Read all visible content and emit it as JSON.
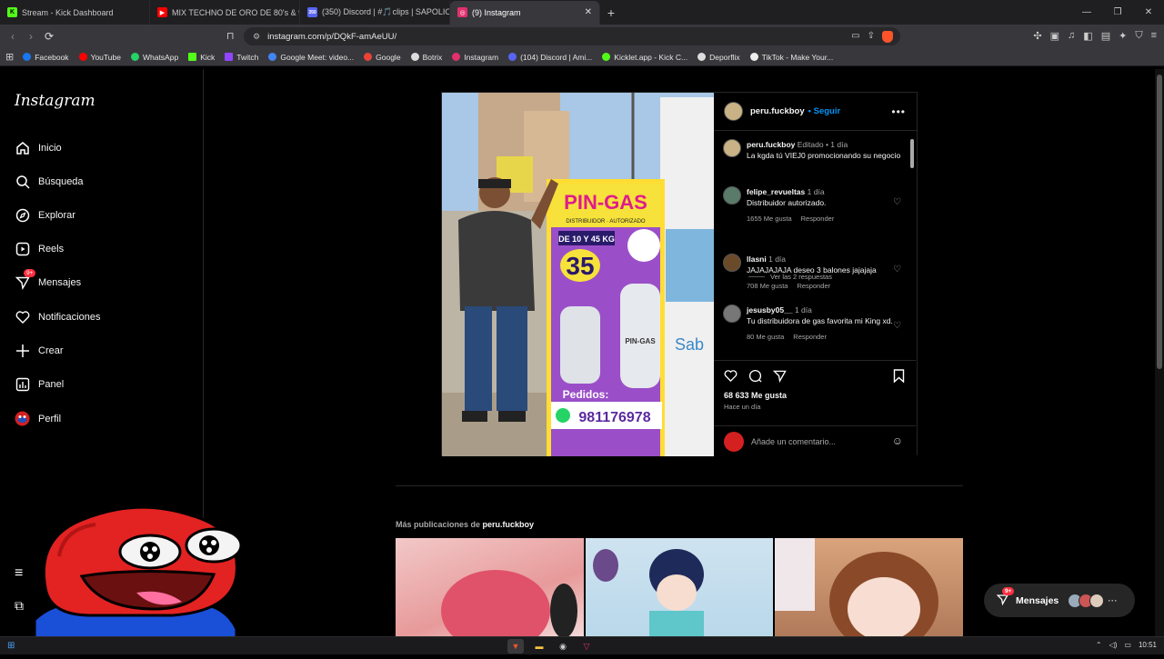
{
  "browser": {
    "tabs": [
      {
        "title": "Stream - Kick Dashboard",
        "color": "#53fc18",
        "glyph": "K"
      },
      {
        "title": "MIX TECHNO DE ORO DE 80's & 90's",
        "color": "#ff0000",
        "glyph": "▶"
      },
      {
        "title": "(350) Discord | #🎵clips | SAPOLIO",
        "color": "#5865f2",
        "glyph": "350"
      },
      {
        "title": "(9) Instagram",
        "color": "#e1306c",
        "glyph": "◎",
        "active": true
      }
    ],
    "new_tab": "+",
    "window_controls": [
      "—",
      "❐",
      "✕"
    ],
    "url": "instagram.com/p/DQkF-amAeUU/",
    "bookmarks": [
      {
        "label": "Facebook",
        "color": "#1877f2"
      },
      {
        "label": "YouTube",
        "color": "#ff0000"
      },
      {
        "label": "WhatsApp",
        "color": "#25d366"
      },
      {
        "label": "Kick",
        "color": "#53fc18"
      },
      {
        "label": "Twitch",
        "color": "#9146ff"
      },
      {
        "label": "Google Meet: video...",
        "color": "#4285f4"
      },
      {
        "label": "Google",
        "color": "#ea4335"
      },
      {
        "label": "Botrix",
        "color": "#dddddd"
      },
      {
        "label": "Instagram",
        "color": "#e1306c"
      },
      {
        "label": "(104) Discord | Ami...",
        "color": "#5865f2"
      },
      {
        "label": "Kicklet.app - Kick C...",
        "color": "#53fc18"
      },
      {
        "label": "Deporflix",
        "color": "#dddddd"
      },
      {
        "label": "TikTok - Make Your...",
        "color": "#eeeeee"
      }
    ]
  },
  "sidebar": {
    "logo": "Instagram",
    "badge": "9+",
    "items": [
      {
        "label": "Inicio",
        "icon": "home-icon"
      },
      {
        "label": "Búsqueda",
        "icon": "search-icon"
      },
      {
        "label": "Explorar",
        "icon": "compass-icon"
      },
      {
        "label": "Reels",
        "icon": "reels-icon"
      },
      {
        "label": "Mensajes",
        "icon": "messages-icon"
      },
      {
        "label": "Notificaciones",
        "icon": "heart-icon"
      },
      {
        "label": "Crear",
        "icon": "plus-icon"
      },
      {
        "label": "Panel",
        "icon": "panel-icon"
      },
      {
        "label": "Perfil",
        "icon": "profile-avatar-icon"
      }
    ]
  },
  "post": {
    "username": "peru.fuckboy",
    "follow": "• Seguir",
    "image_text": {
      "brand": "PIN-GAS",
      "subtitle": "DISTRIBUIDOR · AUTORIZADO",
      "sizes": "DE 10 Y 45 KG",
      "price": "35",
      "cylinder_label": "PIN-GAS",
      "orders": "Pedidos:",
      "phone": "981176978",
      "side_text": "Sab"
    },
    "caption": {
      "user": "peru.fuckboy",
      "edited": "Editado •",
      "time": "1 día",
      "text": "La kgda  tú VIEJ0 promocionando su negocio"
    },
    "comments": [
      {
        "user": "felipe_revueltas",
        "time": "1 día",
        "text": "Distribuidor autorizado.",
        "likes": "1655 Me gusta",
        "reply": "Responder",
        "avatar_color": "#5a7a6a"
      },
      {
        "user": "llasni",
        "time": "1 día",
        "text": "JAJAJAJAJA deseo 3 balones jajajaja",
        "likes": "708 Me gusta",
        "reply": "Responder",
        "avatar_color": "#6b4a2a"
      },
      {
        "user": "jesusby05__",
        "time": "1 día",
        "text": "Tu distribuidora de gas favorita mi King xd.",
        "likes": "80 Me gusta",
        "reply": "Responder",
        "avatar_color": "#777777"
      }
    ],
    "view_replies": "Ver las 2 respuestas",
    "likes_total": "68 633 Me gusta",
    "posted": "Hace un día",
    "add_comment_placeholder": "Añade un comentario..."
  },
  "more_posts": {
    "prefix": "Más publicaciones de",
    "user": "peru.fuckboy"
  },
  "messages_pill": {
    "label": "Mensajes",
    "badge": "9+"
  },
  "taskbar": {
    "clock": "10:51"
  }
}
